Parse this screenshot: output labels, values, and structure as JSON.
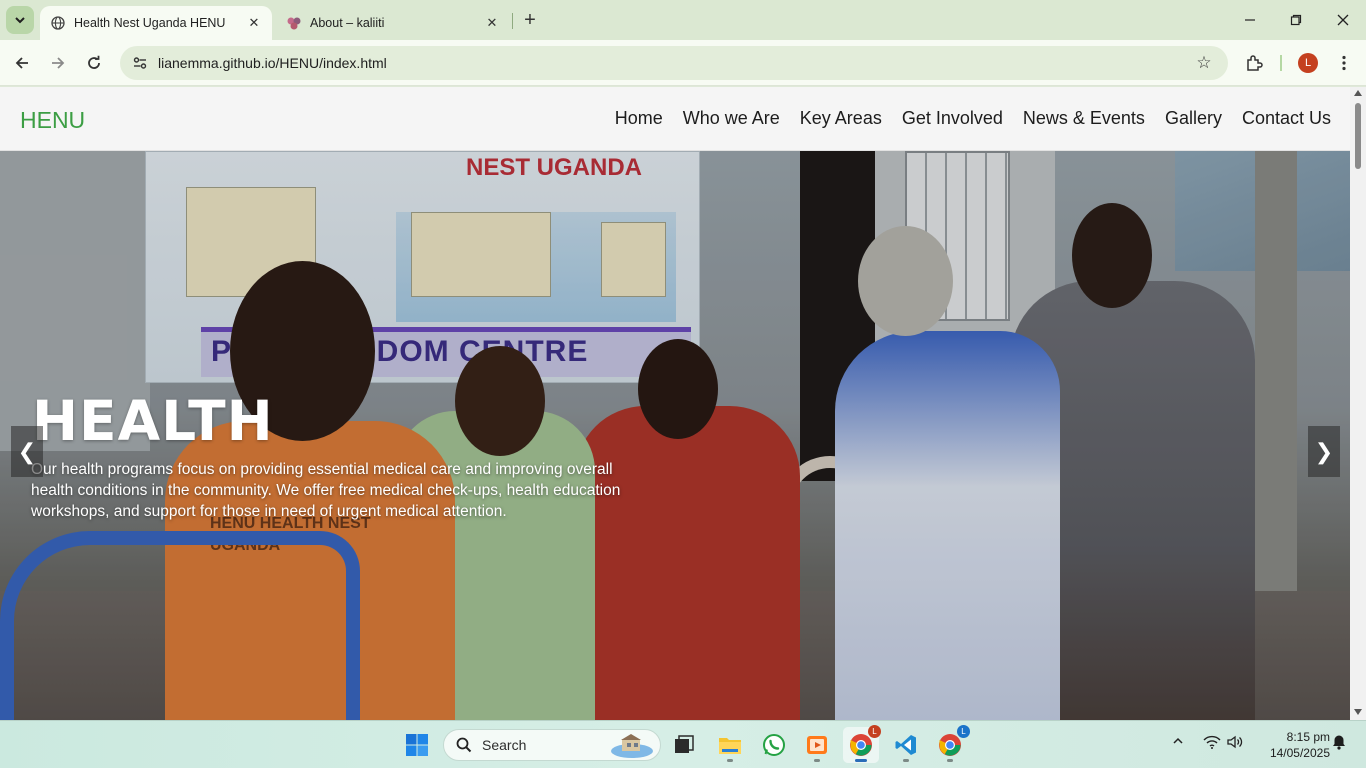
{
  "browser": {
    "tabs": [
      {
        "title": "Health Nest Uganda HENU",
        "active": true
      },
      {
        "title": "About – kaliiti",
        "active": false
      }
    ],
    "address": "lianemma.github.io/HENU/index.html",
    "profile_initial": "L"
  },
  "site": {
    "brand": "HENU",
    "brand_color": "#3c9e44",
    "menu": [
      "Home",
      "Who we Are",
      "Key Areas",
      "Get Involved",
      "News & Events",
      "Gallery",
      "Contact Us"
    ]
  },
  "hero": {
    "title": "HEALTH",
    "text": "Our health programs focus on providing essential medical care and improving overall health conditions in the community. We offer free medical check-ups, health education workshops, and support for those in need of urgent medical attention.",
    "prev_arrow": "❮",
    "next_arrow": "❯",
    "photo_text": {
      "banner_red": "NEST UGANDA",
      "banner_purple": "PR   ED WISDOM CENTRE",
      "vest": "HENU   HEALTH NEST UGANDA"
    }
  },
  "taskbar": {
    "search_label": "Search",
    "time": "8:15 pm",
    "date": "14/05/2025",
    "chrome_badge_1": "L",
    "chrome_badge_2": "L"
  }
}
